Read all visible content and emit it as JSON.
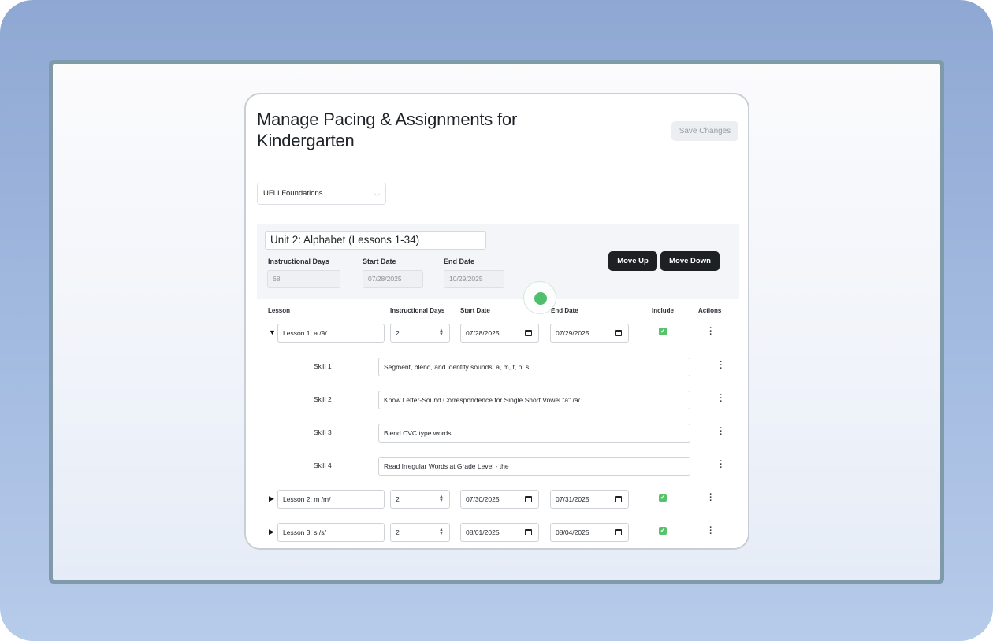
{
  "page": {
    "title": "Manage Pacing & Assignments for Kindergarten",
    "save_label": "Save Changes",
    "program_select": "UFLI Foundations"
  },
  "unit": {
    "title": "Unit 2: Alphabet (Lessons 1-34)",
    "instructional_days_label": "Instructional Days",
    "start_date_label": "Start Date",
    "end_date_label": "End Date",
    "instructional_days": "68",
    "start_date": "07/28/2025",
    "end_date": "10/29/2025",
    "move_up_label": "Move Up",
    "move_down_label": "Move Down"
  },
  "table": {
    "headers": {
      "lesson": "Lesson",
      "days": "Instructional Days",
      "start": "Start Date",
      "end": "End Date",
      "include": "Include",
      "actions": "Actions"
    },
    "lessons": [
      {
        "name": "Lesson 1: a /ă/",
        "days": "2",
        "start": "07/28/2025",
        "end": "07/29/2025",
        "expanded": true,
        "include": true
      },
      {
        "name": "Lesson 2: m /m/",
        "days": "2",
        "start": "07/30/2025",
        "end": "07/31/2025",
        "expanded": false,
        "include": true
      },
      {
        "name": "Lesson 3: s /s/",
        "days": "2",
        "start": "08/01/2025",
        "end": "08/04/2025",
        "expanded": false,
        "include": true
      }
    ],
    "skills": [
      {
        "label": "Skill 1",
        "text": "Segment, blend, and identify sounds: a, m, t, p, s"
      },
      {
        "label": "Skill 2",
        "text": "Know Letter-Sound Correspondence for Single Short Vowel \"a\" /ă/"
      },
      {
        "label": "Skill 3",
        "text": "Blend CVC type words"
      },
      {
        "label": "Skill 4",
        "text": "Read Irregular Words at Grade Level - the"
      }
    ]
  },
  "glyphs": {
    "expanded": "▼",
    "collapsed": "▶",
    "check": "✓",
    "chevron": "⌵"
  },
  "colors": {
    "background": "#8fa8d3",
    "include_check": "#56c26a",
    "dark_button": "#1e2124",
    "cursor": "#4fbf6b"
  }
}
